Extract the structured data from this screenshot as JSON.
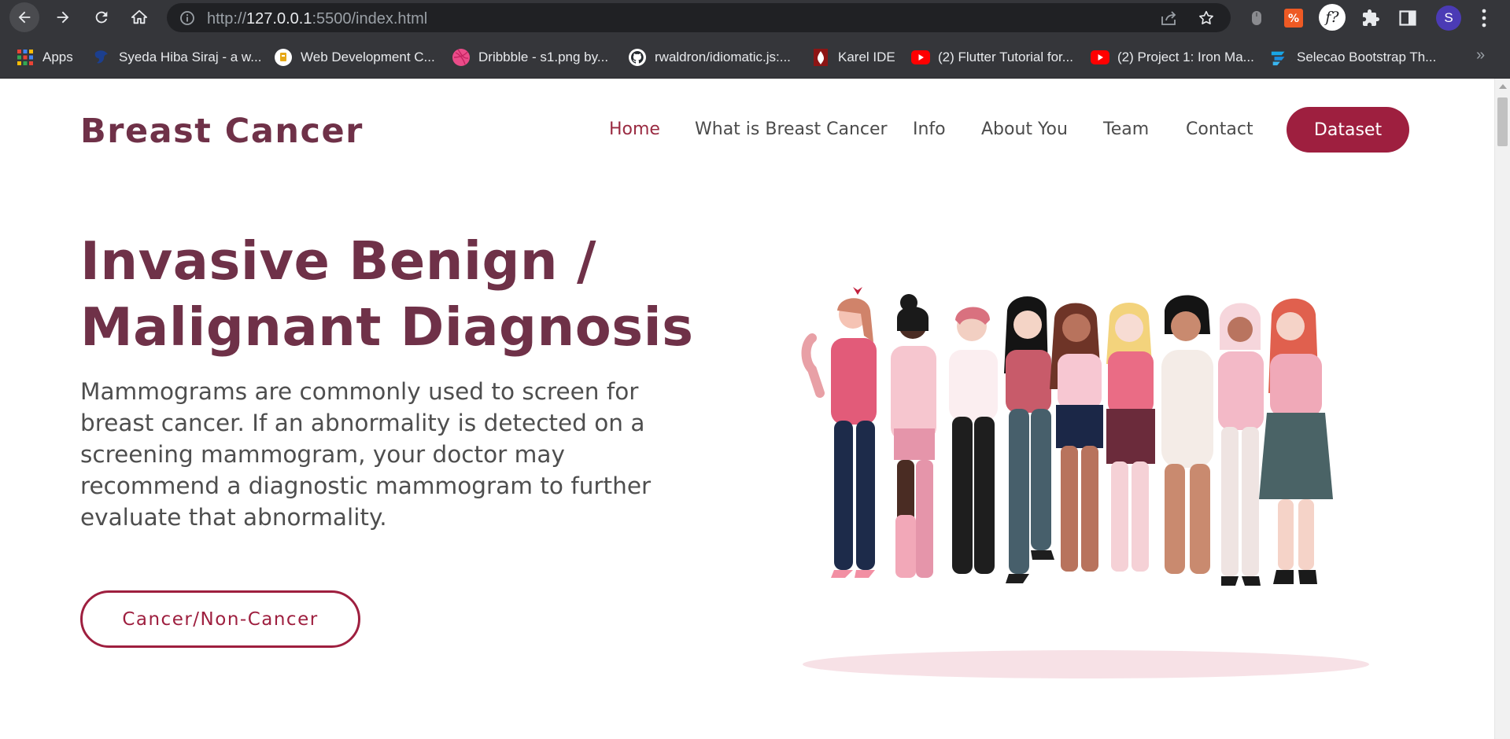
{
  "browser": {
    "url_scheme": "http://",
    "url_host": "127.0.0.1",
    "url_rest": ":5500/index.html",
    "profile_initial": "S",
    "bookmarks": [
      {
        "label": "Apps",
        "icon": "apps-grid-icon"
      },
      {
        "label": "Syeda Hiba Siraj - a w...",
        "icon": "site-icon"
      },
      {
        "label": "Web Development C...",
        "icon": "site-icon"
      },
      {
        "label": "Dribbble - s1.png by...",
        "icon": "dribbble-icon"
      },
      {
        "label": "rwaldron/idiomatic.js:...",
        "icon": "github-icon"
      },
      {
        "label": "Karel IDE",
        "icon": "stanford-icon"
      },
      {
        "label": "(2) Flutter Tutorial for...",
        "icon": "youtube-icon"
      },
      {
        "label": "(2) Project 1: Iron Ma...",
        "icon": "youtube-icon"
      },
      {
        "label": "Selecao Bootstrap Th...",
        "icon": "bootstrap-theme-icon"
      }
    ],
    "more_bookmarks": "»"
  },
  "site": {
    "brand": "Breast Cancer",
    "nav": [
      {
        "label": "Home",
        "active": true
      },
      {
        "label": "What is Breast Cancer",
        "active": false
      },
      {
        "label": "Info",
        "active": false
      },
      {
        "label": "About You",
        "active": false
      },
      {
        "label": "Team",
        "active": false
      },
      {
        "label": "Contact",
        "active": false
      }
    ],
    "cta_label": "Dataset"
  },
  "hero": {
    "title_line1": "Invasive Benign /",
    "title_line2": "Malignant Diagnosis",
    "text": "Mammograms are commonly used to screen for breast cancer. If an abnormality is detected on a screening mammogram, your doctor may recommend a diagnostic mammogram to further evaluate that abnormality.",
    "button_label": "Cancer/Non-Cancer",
    "illustration": "group-of-women-illustration"
  },
  "colors": {
    "brand": "#6f3148",
    "accent": "#9e1f3f",
    "nav_text": "#4b4b4b",
    "body_text": "#4e4e4e",
    "chrome_bg": "#35363a"
  }
}
